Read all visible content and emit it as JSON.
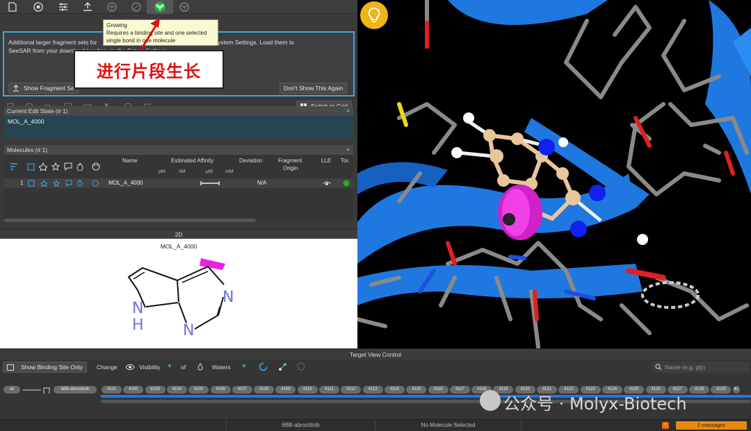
{
  "tooltip": {
    "title": "Growing",
    "line1": "Requires a binding site and one selected",
    "line2": "single bond in one molecule"
  },
  "banner": {
    "text": "进行片段生长"
  },
  "info": {
    "line1a": "Additional larger fragment sets for",
    "line1b": "r later from the System Settings. Load them to",
    "line2a": "SeeSAR from your download location via the S",
    "line2b": "stem Settings."
  },
  "buttons": {
    "show_fragment": "Show Fragment Se",
    "dont_show": "Don't Show This Again",
    "switch_grid": "Switch to Grid"
  },
  "edit_state": {
    "header": "Current Edit State  (# 1)",
    "value": "MOL_A_4000"
  },
  "molecules": {
    "header": "Molecules  (# 1)",
    "columns": {
      "name": "Name",
      "affinity": "Estimated Affinity",
      "deviation": "Deviation",
      "fragment": "Fragment",
      "origin": "Origin",
      "lle": "LLE",
      "tor": "Tor."
    },
    "units": {
      "pm": "pM",
      "nm": "nM",
      "um": "µM",
      "mm": "mM"
    },
    "rows": [
      {
        "index": "1",
        "name": "MOL_A_4000",
        "deviation": "N/A"
      }
    ]
  },
  "twod": {
    "header": "2D",
    "mol_name": "MOL_A_4000",
    "atom_n1": "N",
    "atom_n2": "N",
    "atom_nh_n": "N",
    "atom_nh_h": "H"
  },
  "target_view": {
    "header": "Target View Control",
    "show_binding": "Show Binding Site Only",
    "change": "Change",
    "visibility": "Visibility",
    "of": "of",
    "waters": "Waters",
    "search_placeholder": "Name (e.g. gly)"
  },
  "chain": {
    "all": "all",
    "label": "6BB-abrocitinib"
  },
  "residues": [
    "4101",
    "4102",
    "4103",
    "4104",
    "4105",
    "4106",
    "4107",
    "4108",
    "4109",
    "4110",
    "4111",
    "4112",
    "4113",
    "4114",
    "4115",
    "4116",
    "4117",
    "4118",
    "4119",
    "4120",
    "4121",
    "4122",
    "4123",
    "4124",
    "4125",
    "4126",
    "4127",
    "4128",
    "4129",
    "41"
  ],
  "status": {
    "target": "6BB-abrocitinib",
    "molecule": "No Molecule Selected",
    "messages": "2 messages"
  },
  "watermark": "公众号 · Molyx-Biotech",
  "colors": {
    "accent_blue": "#3ba7e0",
    "banner_red": "#e01010",
    "growing_green": "#22b04a",
    "status_orange": "#e88a10",
    "protein_blue": "#1f78e0",
    "magenta": "#d020c8"
  }
}
